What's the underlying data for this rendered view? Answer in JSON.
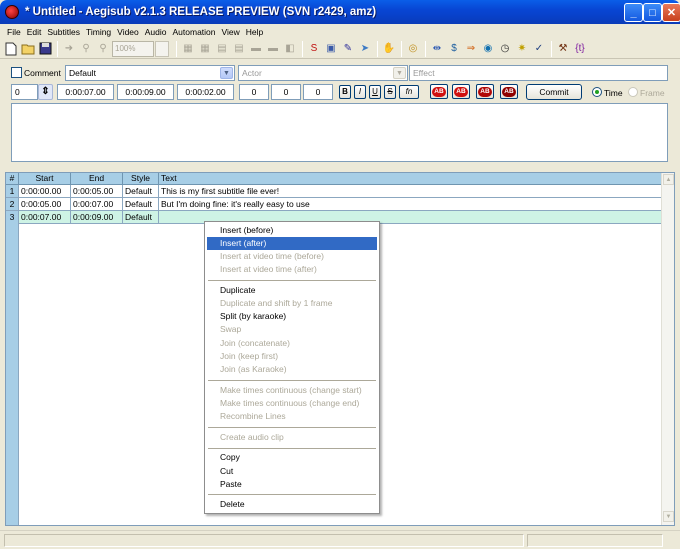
{
  "window": {
    "title": "* Untitled - Aegisub v2.1.3 RELEASE PREVIEW (SVN r2429, amz)",
    "min_label": "_",
    "max_label": "□",
    "close_label": "✕"
  },
  "menu": [
    "File",
    "Edit",
    "Subtitles",
    "Timing",
    "Video",
    "Audio",
    "Automation",
    "View",
    "Help"
  ],
  "toolbar": {
    "zoom_value": "100%"
  },
  "edit": {
    "comment_label": "Comment",
    "style_value": "Default",
    "actor_placeholder": "Actor",
    "effect_placeholder": "Effect",
    "layer_value": "0",
    "start_time": "0:00:07.00",
    "end_time": "0:00:09.00",
    "duration": "0:00:02.00",
    "margin_l": "0",
    "margin_r": "0",
    "margin_v": "0",
    "bold": "B",
    "italic": "I",
    "underline": "U",
    "strike": "S",
    "font": "fn",
    "color_label": "AB",
    "commit_label": "Commit",
    "time_label": "Time",
    "frame_label": "Frame"
  },
  "grid": {
    "headers": [
      "#",
      "Start",
      "End",
      "Style",
      "Text"
    ],
    "rows": [
      {
        "num": "1",
        "start": "0:00:00.00",
        "end": "0:00:05.00",
        "style": "Default",
        "text": "This is my first subtitle file ever!"
      },
      {
        "num": "2",
        "start": "0:00:05.00",
        "end": "0:00:07.00",
        "style": "Default",
        "text": "But I'm doing fine: it's really easy to use"
      },
      {
        "num": "3",
        "start": "0:00:07.00",
        "end": "0:00:09.00",
        "style": "Default",
        "text": ""
      }
    ]
  },
  "context_menu": [
    {
      "label": "Insert (before)",
      "enabled": true
    },
    {
      "label": "Insert (after)",
      "enabled": true,
      "highlighted": true
    },
    {
      "label": "Insert at video time (before)",
      "enabled": false
    },
    {
      "label": "Insert at video time (after)",
      "enabled": false
    },
    {
      "label": "Duplicate",
      "enabled": true
    },
    {
      "label": "Duplicate and shift by 1 frame",
      "enabled": false
    },
    {
      "label": "Split (by karaoke)",
      "enabled": true
    },
    {
      "label": "Swap",
      "enabled": false
    },
    {
      "label": "Join (concatenate)",
      "enabled": false
    },
    {
      "label": "Join (keep first)",
      "enabled": false
    },
    {
      "label": "Join (as Karaoke)",
      "enabled": false
    },
    {
      "label": "Make times continuous (change start)",
      "enabled": false
    },
    {
      "label": "Make times continuous (change end)",
      "enabled": false
    },
    {
      "label": "Recombine Lines",
      "enabled": false
    },
    {
      "label": "Create audio clip",
      "enabled": false
    },
    {
      "label": "Copy",
      "enabled": true
    },
    {
      "label": "Cut",
      "enabled": true
    },
    {
      "label": "Paste",
      "enabled": true
    },
    {
      "label": "Delete",
      "enabled": true
    }
  ]
}
